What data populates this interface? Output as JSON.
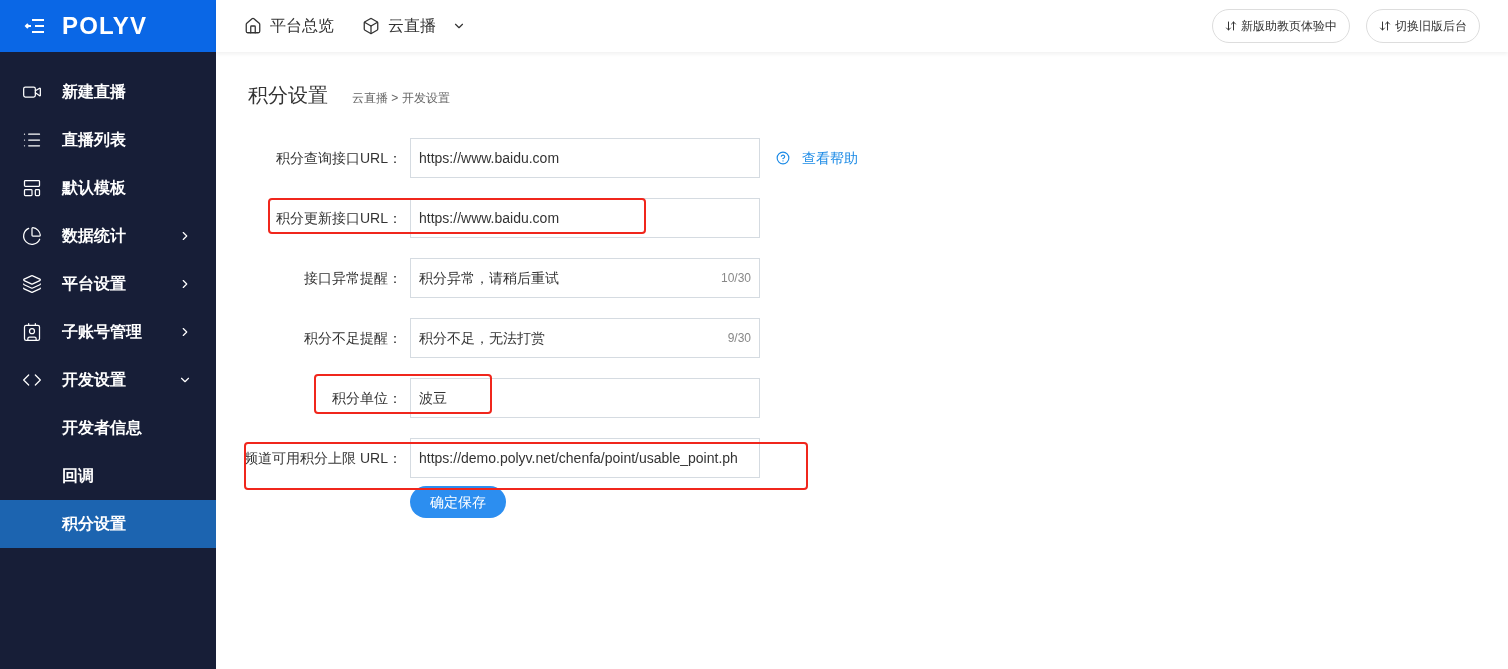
{
  "header": {
    "logo": "POLYV",
    "nav": [
      {
        "label": "平台总览",
        "dropdown": false
      },
      {
        "label": "云直播",
        "dropdown": true
      }
    ],
    "buttons": [
      "新版助教页体验中",
      "切换旧版后台"
    ]
  },
  "sidebar": {
    "items": [
      {
        "kind": "link",
        "label": "新建直播",
        "selected": false
      },
      {
        "kind": "link",
        "label": "直播列表",
        "selected": false
      },
      {
        "kind": "link",
        "label": "默认模板",
        "selected": false
      },
      {
        "kind": "group",
        "label": "数据统计",
        "expanded": false,
        "selected": false
      },
      {
        "kind": "group",
        "label": "平台设置",
        "expanded": false,
        "selected": false
      },
      {
        "kind": "group",
        "label": "子账号管理",
        "expanded": false,
        "selected": false
      },
      {
        "kind": "group",
        "label": "开发设置",
        "expanded": true,
        "selected": false,
        "children": [
          {
            "label": "开发者信息",
            "selected": false
          },
          {
            "label": "回调",
            "selected": false
          },
          {
            "label": "积分设置",
            "selected": true
          }
        ]
      }
    ]
  },
  "page": {
    "title": "积分设置",
    "breadcrumb": [
      "云直播 >",
      "开发设置"
    ]
  },
  "form": {
    "rows": [
      {
        "label": "积分查询接口URL：",
        "value": "https://www.baidu.com",
        "help": "查看帮助",
        "highlighted": false
      },
      {
        "label": "积分更新接口URL：",
        "value": "https://www.baidu.com",
        "highlighted": true
      },
      {
        "label": "接口异常提醒：",
        "value": "积分异常，请稍后重试",
        "counter": "10/30",
        "highlighted": false
      },
      {
        "label": "积分不足提醒：",
        "value": "积分不足，无法打赏",
        "counter": "9/30",
        "highlighted": false
      },
      {
        "label": "积分单位：",
        "value": "波豆",
        "highlighted": true
      },
      {
        "label": "频道可用积分上限 URL：",
        "value": "https://demo.polyv.net/chenfa/point/usable_point.ph",
        "highlighted": true
      }
    ],
    "submit": "确定保存"
  }
}
